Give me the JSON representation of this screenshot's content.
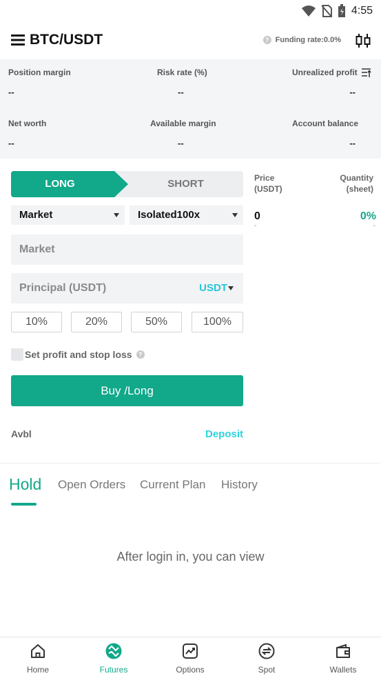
{
  "status_bar": {
    "time": "4:55"
  },
  "header": {
    "pair": "BTC/USDT",
    "funding_rate": "Funding rate:0.0%"
  },
  "account": {
    "position_margin": {
      "label": "Position margin",
      "value": "--"
    },
    "risk_rate": {
      "label": "Risk rate (%)",
      "value": "--"
    },
    "unrealized_profit": {
      "label": "Unrealized profit",
      "value": "--"
    },
    "net_worth": {
      "label": "Net worth",
      "value": "--"
    },
    "available_margin": {
      "label": "Available margin",
      "value": "--"
    },
    "account_balance": {
      "label": "Account balance",
      "value": "--"
    }
  },
  "trade": {
    "long_label": "LONG",
    "short_label": "SHORT",
    "order_type": "Market",
    "leverage": "Isolated100x",
    "price_field": "Market",
    "principal_placeholder": "Principal (USDT)",
    "principal_unit": "USDT",
    "percentages": [
      "10%",
      "20%",
      "50%",
      "100%"
    ],
    "tpsl_label": "Set profit and stop loss",
    "buy_label": "Buy /Long",
    "avbl_label": "Avbl",
    "deposit_label": "Deposit"
  },
  "order_book": {
    "price_header_1": "Price",
    "price_header_2": "(USDT)",
    "qty_header_1": "Quantity",
    "qty_header_2": "(sheet)",
    "price": "0",
    "percent": "0%",
    "price_sub": "-",
    "percent_sub": "-"
  },
  "tabs": [
    "Hold",
    "Open Orders",
    "Current Plan",
    "History"
  ],
  "login_message": "After login in, you can view",
  "nav": {
    "home": "Home",
    "futures": "Futures",
    "options": "Options",
    "spot": "Spot",
    "wallets": "Wallets"
  },
  "colors": {
    "accent": "#12a88a",
    "cyan": "#26c6da"
  }
}
